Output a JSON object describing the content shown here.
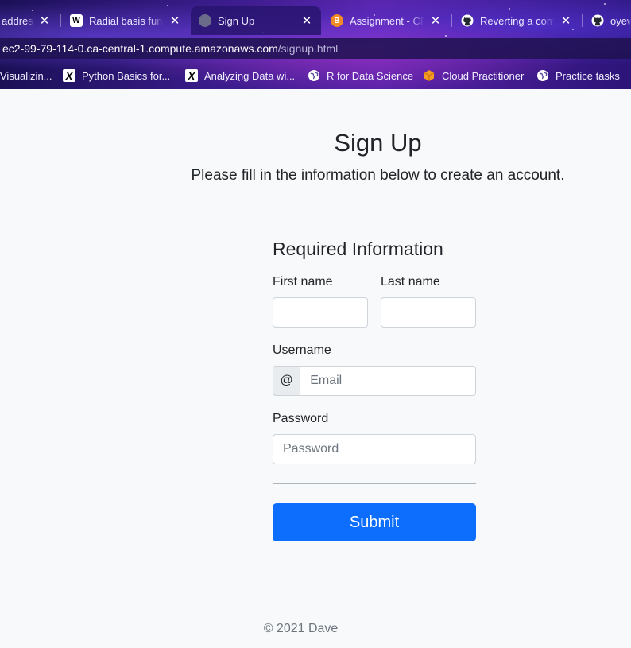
{
  "tabs": [
    {
      "label": "address",
      "icon": "page-icon",
      "active": false
    },
    {
      "label": "Radial basis function",
      "icon": "wikipedia-icon",
      "active": false
    },
    {
      "label": "Sign Up",
      "icon": "globe-icon",
      "active": true
    },
    {
      "label": "Assignment - CP",
      "icon": "brightspace-icon",
      "active": false
    },
    {
      "label": "Reverting a commit",
      "icon": "github-icon",
      "active": false
    },
    {
      "label": "oyew",
      "icon": "github-icon",
      "active": false
    }
  ],
  "address": {
    "host": "ec2-99-79-114-0.ca-central-1.compute.amazonaws.com",
    "path": "/signup.html"
  },
  "bookmarks": [
    {
      "label": "Visualizin...",
      "icon": "none"
    },
    {
      "label": "Python Basics for...",
      "icon": "edx-x-icon"
    },
    {
      "label": "Analyzing Data wi...",
      "icon": "edx-x-icon"
    },
    {
      "label": "R for Data Science",
      "icon": "globe-icon"
    },
    {
      "label": "Cloud Practitioner",
      "icon": "aws-cube-icon"
    },
    {
      "label": "Practice tasks",
      "icon": "globe-icon"
    }
  ],
  "page": {
    "title": "Sign Up",
    "subtitle": "Please fill in the information below to create an account."
  },
  "form": {
    "section_title": "Required Information",
    "first_name_label": "First name",
    "first_name_value": "",
    "last_name_label": "Last name",
    "last_name_value": "",
    "username_label": "Username",
    "username_addon": "@",
    "username_placeholder": "Email",
    "password_label": "Password",
    "password_placeholder": "Password",
    "submit_label": "Submit"
  },
  "footer": {
    "text": "© 2021 Dave"
  },
  "colors": {
    "primary": "#0d6efd",
    "background": "#f8f9fa"
  }
}
